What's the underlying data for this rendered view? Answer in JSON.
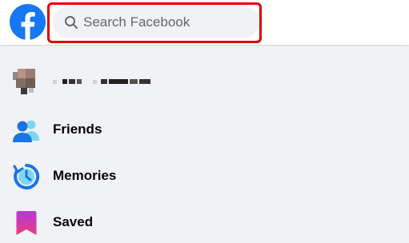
{
  "header": {
    "search": {
      "placeholder": "Search Facebook",
      "value": ""
    }
  },
  "colors": {
    "brand_blue": "#1877f2",
    "highlight_red": "#e00000",
    "page_bg": "#f0f2f5"
  },
  "sidebar": {
    "items": [
      {
        "label": "",
        "icon": "profile-avatar"
      },
      {
        "label": "Friends",
        "icon": "friends-icon"
      },
      {
        "label": "Memories",
        "icon": "memories-icon"
      },
      {
        "label": "Saved",
        "icon": "saved-icon"
      }
    ]
  }
}
